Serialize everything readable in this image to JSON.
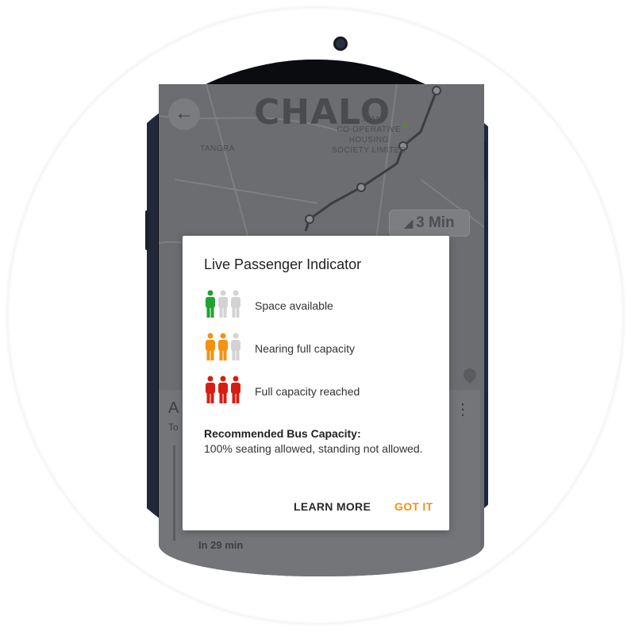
{
  "map": {
    "brand": "CHALO",
    "labels": {
      "tangra": "TANGRA",
      "society": "...ITAN\nCO-OPERATIVE\nHOUSING\nSOCIETY LIMITED"
    },
    "eta": "3 Min"
  },
  "sheet": {
    "title": "A",
    "sub": "To",
    "time": "In 29 min"
  },
  "dialog": {
    "title": "Live Passenger Indicator",
    "levels": [
      {
        "label": "Space available",
        "filled": 1,
        "color": "#22a131"
      },
      {
        "label": "Nearing full capacity",
        "filled": 2,
        "color": "#f39212"
      },
      {
        "label": "Full capacity reached",
        "filled": 3,
        "color": "#d81e13"
      }
    ],
    "empty_color": "#d3d3d3",
    "recommended_title": "Recommended Bus Capacity:",
    "recommended_body": "100% seating allowed, standing not allowed.",
    "learn_more": "LEARN MORE",
    "got_it": "GOT IT",
    "got_it_color": "#f39212"
  }
}
